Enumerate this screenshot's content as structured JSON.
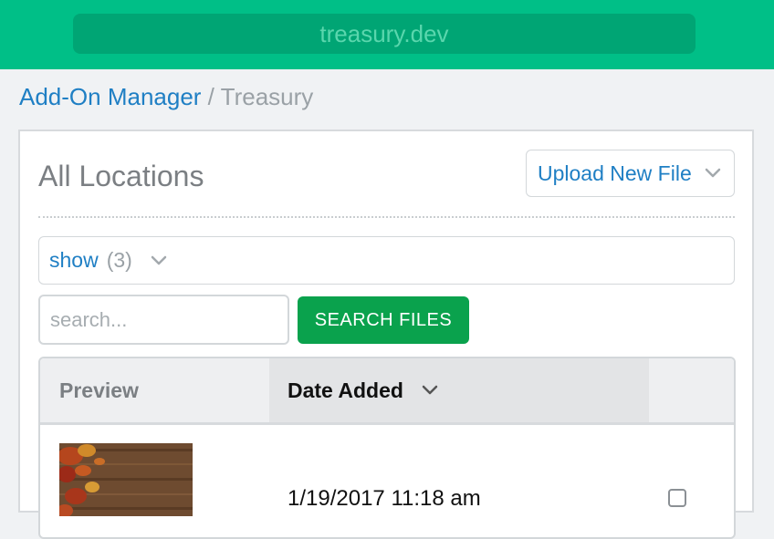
{
  "browser": {
    "url": "treasury.dev"
  },
  "breadcrumb": {
    "parent": "Add-On Manager",
    "separator": " / ",
    "current": "Treasury"
  },
  "panel": {
    "title": "All Locations",
    "upload_label": "Upload New File"
  },
  "filter": {
    "show_label": "show",
    "count": "(3)"
  },
  "search": {
    "placeholder": "search...",
    "value": "",
    "button_label": "SEARCH FILES"
  },
  "table": {
    "columns": [
      "Preview",
      "Date Added"
    ],
    "rows": [
      {
        "preview": "autumn-leaves-on-wood",
        "date": "1/19/2017 11:18 am",
        "selected": false
      }
    ]
  },
  "colors": {
    "header_green": "#00bf87",
    "link_blue": "#1f7fc4",
    "button_green": "#0aa24d"
  }
}
